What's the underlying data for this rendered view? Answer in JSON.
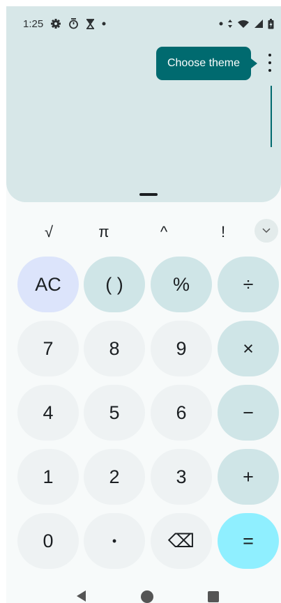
{
  "status_bar": {
    "time": "1:25",
    "left_icons": [
      "gear-icon",
      "timer-icon",
      "hourglass-icon",
      "dot-icon"
    ],
    "right_icons": [
      "dot-icon",
      "data-arrows-icon",
      "wifi-icon",
      "signal-icon",
      "battery-icon"
    ]
  },
  "display": {
    "tooltip": "Choose theme",
    "expression": ""
  },
  "scientific": {
    "sqrt": "√",
    "pi": "π",
    "power": "^",
    "factorial": "!"
  },
  "keys": {
    "ac": "AC",
    "parens": "( )",
    "percent": "%",
    "divide": "÷",
    "seven": "7",
    "eight": "8",
    "nine": "9",
    "multiply": "×",
    "four": "4",
    "five": "5",
    "six": "6",
    "minus": "−",
    "one": "1",
    "two": "2",
    "three": "3",
    "plus": "+",
    "zero": "0",
    "decimal": "•",
    "backspace": "⌫",
    "equals": "="
  },
  "colors": {
    "display_bg": "#d7e7e8",
    "accent": "#006a6f",
    "digit_key": "#eef2f3",
    "operator_key": "#cfe5e7",
    "clear_key": "#dce4fb",
    "equals_key": "#8fefff"
  }
}
